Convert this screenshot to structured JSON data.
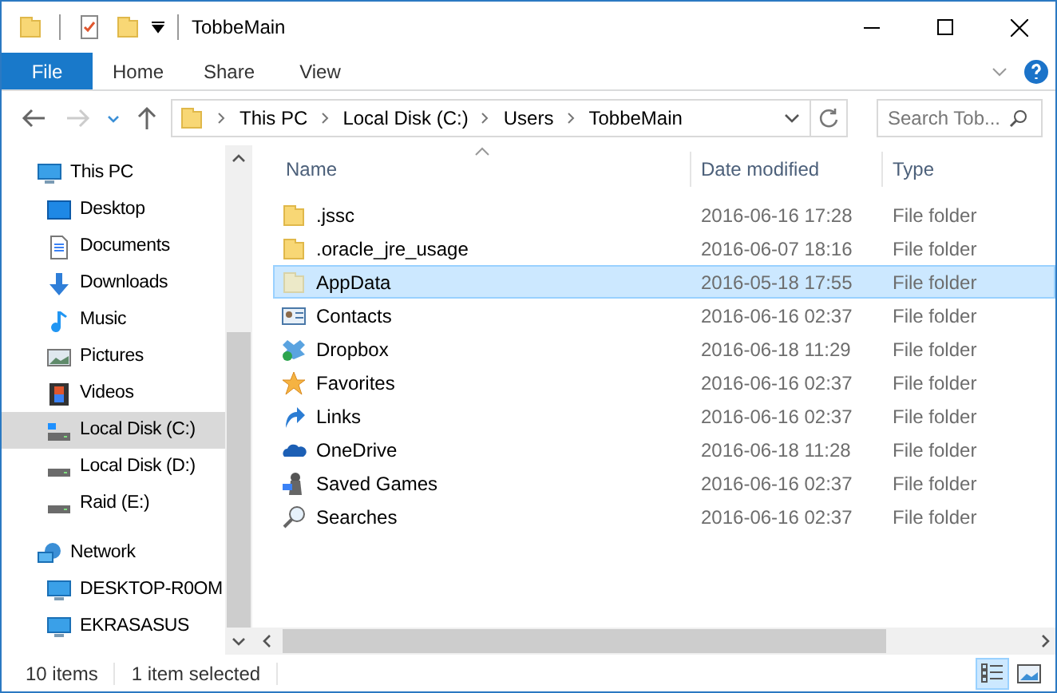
{
  "window": {
    "title": "TobbeMain"
  },
  "ribbon_tabs": [
    {
      "label": "File",
      "selected": true
    },
    {
      "label": "Home",
      "selected": false
    },
    {
      "label": "Share",
      "selected": false
    },
    {
      "label": "View",
      "selected": false
    }
  ],
  "breadcrumb": [
    "This PC",
    "Local Disk (C:)",
    "Users",
    "TobbeMain"
  ],
  "search": {
    "placeholder": "Search Tob..."
  },
  "sidebar": {
    "items": [
      {
        "label": "This PC",
        "selected": false,
        "children": [
          {
            "label": "Desktop",
            "selected": false
          },
          {
            "label": "Documents",
            "selected": false
          },
          {
            "label": "Downloads",
            "selected": false
          },
          {
            "label": "Music",
            "selected": false
          },
          {
            "label": "Pictures",
            "selected": false
          },
          {
            "label": "Videos",
            "selected": false
          },
          {
            "label": "Local Disk (C:)",
            "selected": true
          },
          {
            "label": "Local Disk (D:)",
            "selected": false
          },
          {
            "label": "Raid (E:)",
            "selected": false
          }
        ]
      },
      {
        "label": "Network",
        "selected": false,
        "children": [
          {
            "label": "DESKTOP-R0OM",
            "selected": false
          },
          {
            "label": "EKRASASUS",
            "selected": false
          }
        ]
      }
    ]
  },
  "table": {
    "columns": [
      "Name",
      "Date modified",
      "Type"
    ],
    "rows": [
      {
        "name": ".jssc",
        "date": "2016-06-16 17:28",
        "type": "File folder",
        "selected": false
      },
      {
        "name": ".oracle_jre_usage",
        "date": "2016-06-07 18:16",
        "type": "File folder",
        "selected": false
      },
      {
        "name": "AppData",
        "date": "2016-05-18 17:55",
        "type": "File folder",
        "selected": true
      },
      {
        "name": "Contacts",
        "date": "2016-06-16 02:37",
        "type": "File folder",
        "selected": false
      },
      {
        "name": "Dropbox",
        "date": "2016-06-18 11:29",
        "type": "File folder",
        "selected": false
      },
      {
        "name": "Favorites",
        "date": "2016-06-16 02:37",
        "type": "File folder",
        "selected": false
      },
      {
        "name": "Links",
        "date": "2016-06-16 02:37",
        "type": "File folder",
        "selected": false
      },
      {
        "name": "OneDrive",
        "date": "2016-06-18 11:28",
        "type": "File folder",
        "selected": false
      },
      {
        "name": "Saved Games",
        "date": "2016-06-16 02:37",
        "type": "File folder",
        "selected": false
      },
      {
        "name": "Searches",
        "date": "2016-06-16 02:37",
        "type": "File folder",
        "selected": false
      }
    ]
  },
  "status_bar": {
    "count": "10 items",
    "selection": "1 item selected"
  }
}
